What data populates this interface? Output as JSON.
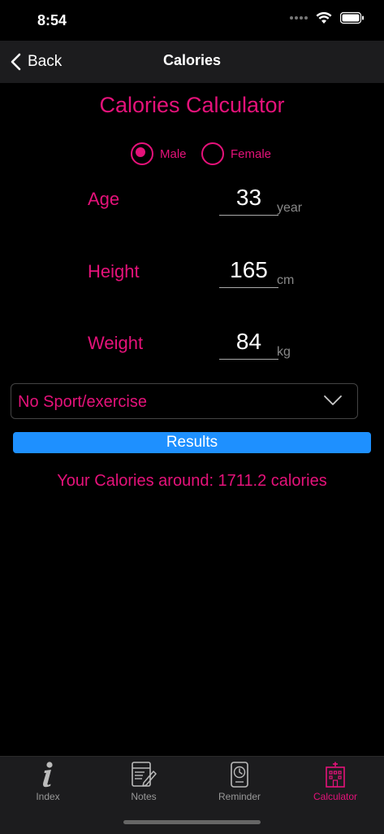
{
  "status": {
    "time": "8:54"
  },
  "nav": {
    "back_label": "Back",
    "title": "Calories"
  },
  "calculator": {
    "title": "Calories Calculator",
    "gender": {
      "options": [
        {
          "label": "Male",
          "selected": true
        },
        {
          "label": "Female",
          "selected": false
        }
      ]
    },
    "fields": [
      {
        "label": "Age",
        "value": "33",
        "unit": "year"
      },
      {
        "label": "Height",
        "value": "165",
        "unit": "cm"
      },
      {
        "label": "Weight",
        "value": "84",
        "unit": "kg"
      }
    ],
    "activity": {
      "selected": "No Sport/exercise"
    },
    "results_label": "Results",
    "result_text": "Your Calories around: 1711.2 calories"
  },
  "tabs": [
    {
      "label": "Index",
      "icon": "info-icon",
      "active": false
    },
    {
      "label": "Notes",
      "icon": "notes-icon",
      "active": false
    },
    {
      "label": "Reminder",
      "icon": "reminder-clock-icon",
      "active": false
    },
    {
      "label": "Calculator",
      "icon": "hospital-icon",
      "active": true
    }
  ],
  "colors": {
    "accent": "#e5127a",
    "button": "#1e90ff",
    "background": "#000000",
    "bar": "#1c1c1e"
  }
}
